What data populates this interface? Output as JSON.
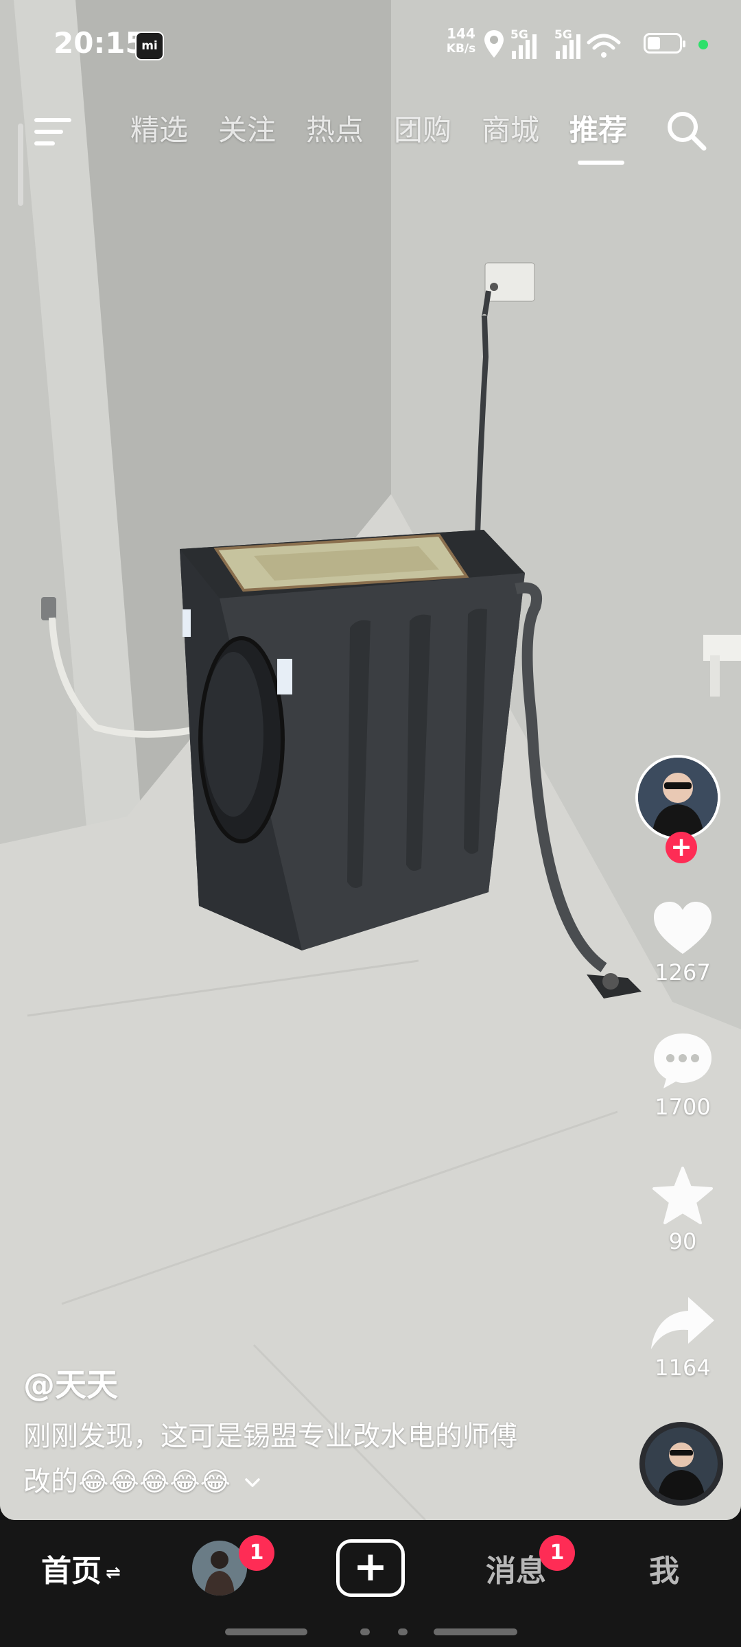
{
  "status_bar": {
    "time": "20:15",
    "app_badge": "mi",
    "net_speed_value": "144",
    "net_speed_unit": "KB/s",
    "signal_1_label": "5G",
    "signal_2_label": "5G",
    "icons": [
      "location-icon",
      "signal-icon",
      "signal-icon",
      "wifi-icon",
      "battery-icon"
    ]
  },
  "top_nav": {
    "tabs": [
      {
        "label": "精选",
        "active": false
      },
      {
        "label": "关注",
        "active": false
      },
      {
        "label": "热点",
        "active": false
      },
      {
        "label": "团购",
        "active": false
      },
      {
        "label": "商城",
        "active": false
      },
      {
        "label": "推荐",
        "active": true
      }
    ],
    "icons": [
      "menu-icon",
      "search-icon"
    ]
  },
  "video": {
    "author": "@天天",
    "description_line1": "刚刚发现，这可是锡盟专业改水电的师傅",
    "description_line2": "改的",
    "emojis": [
      "😂",
      "😂",
      "😂",
      "😂",
      "😂"
    ]
  },
  "side_actions": {
    "follow_plus": "+",
    "likes": "1267",
    "comments": "1700",
    "favorites": "90",
    "shares": "1164"
  },
  "bottom_nav": {
    "home_label": "首页",
    "home_swap": "⇌",
    "friend_badge": "1",
    "create_label": "+",
    "messages_label": "消息",
    "messages_badge": "1",
    "me_label": "我"
  }
}
